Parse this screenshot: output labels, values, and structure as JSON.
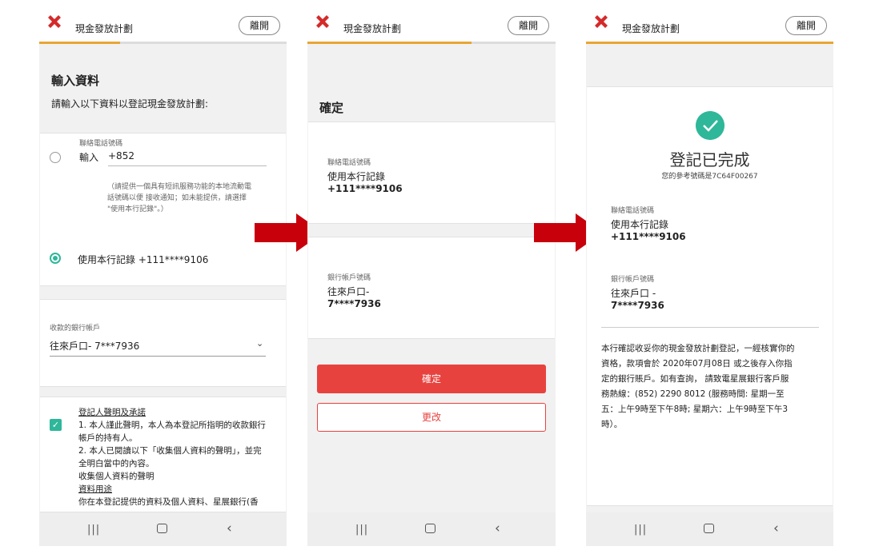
{
  "app": {
    "title": "現金發放計劃",
    "exit_label": "離開"
  },
  "nav_icons": [
    "recent-apps-icon",
    "home-icon",
    "back-icon"
  ],
  "colors": {
    "brand_red": "#d42a2a",
    "progress": "#e8a534",
    "accent_green": "#2fb79a",
    "button_red": "#e8423f",
    "arrow_red": "#c8000b"
  },
  "screen1": {
    "heading": "輸入資料",
    "instruction": "請輸入以下資料以登記現金發放計劃:",
    "phone_label": "聯絡電話號碼",
    "input_option_label": "輸入",
    "country_code": "+852",
    "note_lines": [
      "（請提供一個具有短訊服務功能的本地流動電",
      "話號碼以便 接收通知；如未能提供，請選擇",
      "\"使用本行記錄\"。）"
    ],
    "record_option_label": "使用本行記錄",
    "record_option_phone": "+111****9106",
    "bank_account_label": "收款的銀行帳戶",
    "bank_account_value": "往來戶口- 7***7936",
    "declaration_title": "登記人聲明及承諾",
    "declaration_lines": [
      "1. 本人謹此聲明，本人為本登記所指明的收款銀行",
      "帳戶的持有人。",
      "2. 本人已閱讀以下「收集個人資料的聲明」，並完",
      "全明白當中的內容。",
      "收集個人資料的聲明"
    ],
    "data_usage_title": "資料用途",
    "data_usage_text": "你在本登記提供的資料及個人資料、星展銀行(香"
  },
  "screen2": {
    "heading": "確定",
    "phone_label": "聯絡電話號碼",
    "phone_source": "使用本行記錄",
    "phone_value": "+111****9106",
    "account_label": "銀行帳戶號碼",
    "account_type": "往來戶口-",
    "account_number": "7****7936",
    "confirm_label": "確定",
    "modify_label": "更改"
  },
  "screen3": {
    "success_title": "登記已完成",
    "reference_text": "您的參考號碼是7C64F00267",
    "phone_label": "聯絡電話號碼",
    "phone_source": "使用本行記錄",
    "phone_value": "+111****9106",
    "account_label": "銀行帳戶號碼",
    "account_type": "往來戶口 -",
    "account_number": "7****7936",
    "message_lines": [
      "本行確認收妥你的現金發放計劃登記，一經核實你的",
      "資格，款項會於 2020年07月08日 或之後存入你指",
      "定的銀行賬戶。如有查詢， 請致電星展銀行客戶服",
      "務熱線：(852) 2290 8012 (服務時間: 星期一至",
      "五：上午9時至下午8時; 星期六：上午9時至下午3",
      "時）。"
    ]
  }
}
